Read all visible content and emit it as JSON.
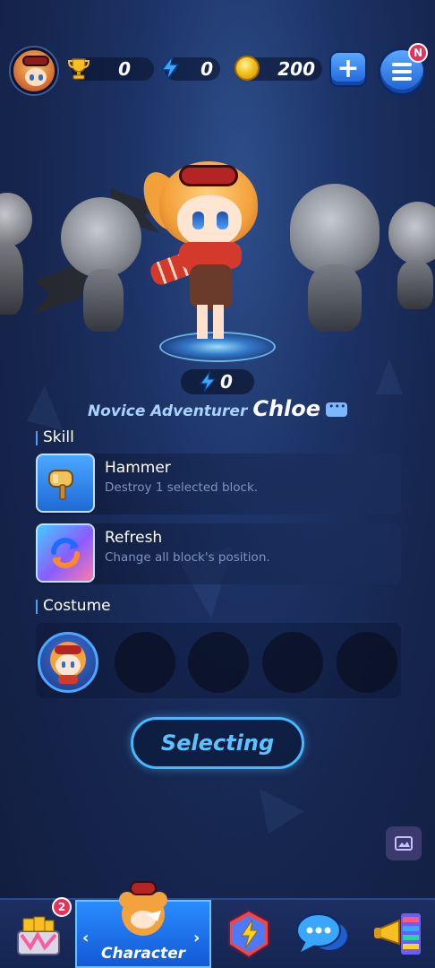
{
  "topbar": {
    "trophies": "0",
    "energy": "0",
    "coins": "200",
    "menu_badge": "N"
  },
  "character": {
    "power": "0",
    "rank": "Novice Adventurer",
    "name": "Chloe"
  },
  "skills": {
    "section_label": "Skill",
    "items": [
      {
        "name": "Hammer",
        "desc": "Destroy 1 selected block.",
        "icon": "hammer-icon"
      },
      {
        "name": "Refresh",
        "desc": "Change all block's position.",
        "icon": "refresh-icon"
      }
    ]
  },
  "costume": {
    "section_label": "Costume"
  },
  "select_button": "Selecting",
  "bottom_nav": {
    "shop_badge": "2",
    "active_label": "Character",
    "items": [
      "shop-icon",
      "character-icon",
      "lightning-badge-icon",
      "chat-bubbles-icon",
      "trumpet-icon"
    ]
  },
  "colors": {
    "accent": "#47b8ff",
    "nav_active": "#1f6ee8",
    "badge": "#e8305a"
  }
}
